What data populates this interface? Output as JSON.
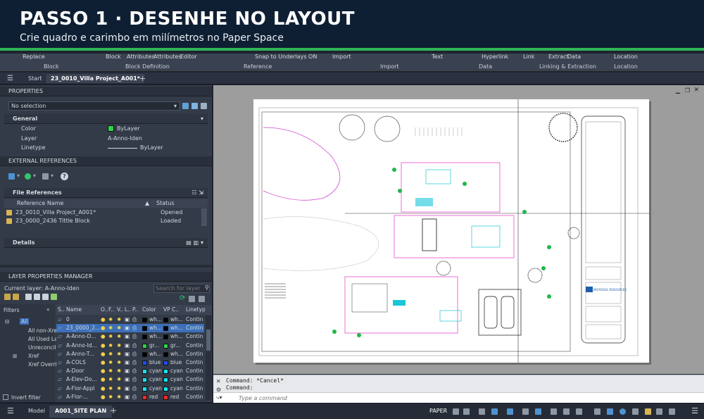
{
  "banner": {
    "title": "PASSO 1 · DESENHE NO LAYOUT",
    "subtitle": "Crie quadro e carimbo em milímetros no Paper Space"
  },
  "ribbon": {
    "buttons": [
      "Replace",
      "Block",
      "Attributes",
      "Attributes",
      "Editor",
      "Snap to Underlays ON",
      "Import",
      "Text",
      "Hyperlink",
      "Link",
      "Extract",
      "Data",
      "Location"
    ],
    "groups": [
      "Block",
      "Block Definition",
      "Reference",
      "Import",
      "Data",
      "Linking & Extraction",
      "Location"
    ]
  },
  "doc_tabs": {
    "start": "Start",
    "active": "23_0010_Villa Project_A001*",
    "close": "×",
    "add": "+"
  },
  "properties": {
    "header": "PROPERTIES",
    "selection": "No selection",
    "general": "General",
    "color_label": "Color",
    "color_value": "ByLayer",
    "layer_label": "Layer",
    "layer_value": "A-Anno-Iden",
    "linetype_label": "Linetype",
    "linetype_value": "ByLayer",
    "color_swatch": "#2fd34a"
  },
  "xrefs": {
    "header": "EXTERNAL REFERENCES",
    "file_refs": "File References",
    "col_name": "Reference Name",
    "col_status": "Status",
    "rows": [
      {
        "name": "23_0010_Villa Project_A001*",
        "status": "Opened"
      },
      {
        "name": "23_0000_2436 Tittle Block",
        "status": "Loaded"
      }
    ],
    "details": "Details"
  },
  "layers": {
    "header": "LAYER PROPERTIES MANAGER",
    "current": "Current layer: A-Anno-Iden",
    "search_placeholder": "Search for layer",
    "filters_label": "Filters",
    "filters": [
      "All",
      "All non-Xre",
      "All Used La",
      "Unreconcile",
      "Xref",
      "Xref Overri"
    ],
    "columns": [
      "S..",
      "Name",
      "O..",
      "F..",
      "V..",
      "L..",
      "P..",
      "Color",
      "VP C..",
      "Linetyp"
    ],
    "rows": [
      {
        "name": "0",
        "color": "wh...",
        "vpcolor": "wh...",
        "linetype": "Contin",
        "swatch": "#000000"
      },
      {
        "name": "23_0000_2...",
        "color": "wh...",
        "vpcolor": "wh...",
        "linetype": "Contin",
        "swatch": "#000000"
      },
      {
        "name": "A-Anno-D...",
        "color": "wh...",
        "vpcolor": "wh...",
        "linetype": "Contin",
        "swatch": "#000000"
      },
      {
        "name": "A-Anno-Id...",
        "color": "gr...",
        "vpcolor": "gr...",
        "linetype": "Contin",
        "swatch": "#2fd34a"
      },
      {
        "name": "A-Anno-T...",
        "color": "wh...",
        "vpcolor": "wh...",
        "linetype": "Contin",
        "swatch": "#000000"
      },
      {
        "name": "A-COLS",
        "color": "blue",
        "vpcolor": "blue",
        "linetype": "Contin",
        "swatch": "#1f4fff"
      },
      {
        "name": "A-Door",
        "color": "cyan",
        "vpcolor": "cyan",
        "linetype": "Contin",
        "swatch": "#19e3ef"
      },
      {
        "name": "A-Elev-Do...",
        "color": "cyan",
        "vpcolor": "cyan",
        "linetype": "Contin",
        "swatch": "#19e3ef"
      },
      {
        "name": "A-Flor-Appl",
        "color": "cyan",
        "vpcolor": "cyan",
        "linetype": "Contin",
        "swatch": "#19e3ef"
      },
      {
        "name": "A-Flor-...",
        "color": "red",
        "vpcolor": "red",
        "linetype": "Contin",
        "swatch": "#ff2a2a"
      }
    ],
    "invert_filter": "Invert filter"
  },
  "command": {
    "line1": "Command: *Cancel*",
    "line2": "Command:",
    "placeholder": "Type a command"
  },
  "status_bar": {
    "model_tab": "Model",
    "layout_tab": "A001_SITE PLAN",
    "add": "+",
    "paper": "PAPER"
  },
  "title_block": {
    "brand": "MICROSOL RESOURCES"
  }
}
